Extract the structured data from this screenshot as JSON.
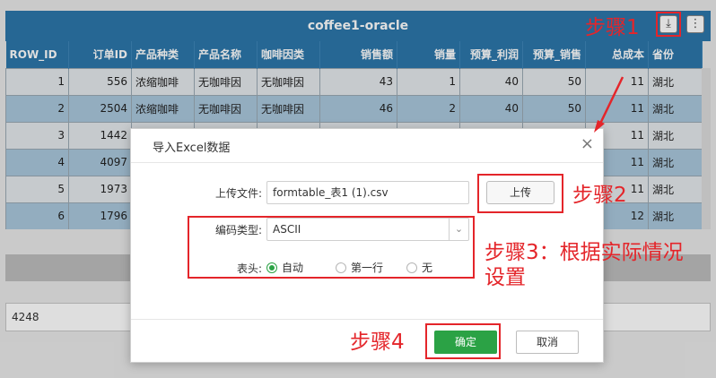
{
  "app": {
    "title": "coffee1-oracle",
    "download_icon": "download-icon",
    "more_icon": "more-vertical-icon"
  },
  "table": {
    "columns": [
      "ROW_ID",
      "订单ID",
      "产品种类",
      "产品名称",
      "咖啡因类",
      "销售额",
      "销量",
      "预算_利润",
      "预算_销售",
      "总成本",
      "省份"
    ],
    "rows": [
      [
        "1",
        "556",
        "浓缩咖啡",
        "无咖啡因",
        "无咖啡因",
        "43",
        "1",
        "40",
        "50",
        "11",
        "湖北"
      ],
      [
        "2",
        "2504",
        "浓缩咖啡",
        "无咖啡因",
        "无咖啡因",
        "46",
        "2",
        "40",
        "50",
        "11",
        "湖北"
      ],
      [
        "3",
        "1442",
        "",
        "",
        "",
        "",
        "",
        "",
        "",
        "11",
        "湖北"
      ],
      [
        "4",
        "4097",
        "",
        "",
        "",
        "",
        "",
        "",
        "",
        "11",
        "湖北"
      ],
      [
        "5",
        "1973",
        "",
        "",
        "",
        "",
        "",
        "",
        "",
        "11",
        "湖北"
      ],
      [
        "6",
        "1796",
        "",
        "",
        "",
        "",
        "",
        "",
        "",
        "12",
        "湖北"
      ]
    ]
  },
  "bottom_field": {
    "value": "4248"
  },
  "dialog": {
    "title": "导入Excel数据",
    "close_icon": "close-icon",
    "file_label": "上传文件:",
    "file_value": "formtable_表1 (1).csv",
    "upload_label": "上传",
    "encoding_label": "编码类型:",
    "encoding_value": "ASCII",
    "header_label": "表头:",
    "header_options": [
      "自动",
      "第一行",
      "无"
    ],
    "header_selected": "自动",
    "ok_label": "确定",
    "cancel_label": "取消"
  },
  "annotations": {
    "step1": "步骤1",
    "step2": "步骤2",
    "step3": "步骤3：根据实际情况设置",
    "step4": "步骤4",
    "color": "#e4252a"
  },
  "accent_colors": {
    "header_blue": "#2c77ab",
    "ok_green": "#2ba245"
  }
}
